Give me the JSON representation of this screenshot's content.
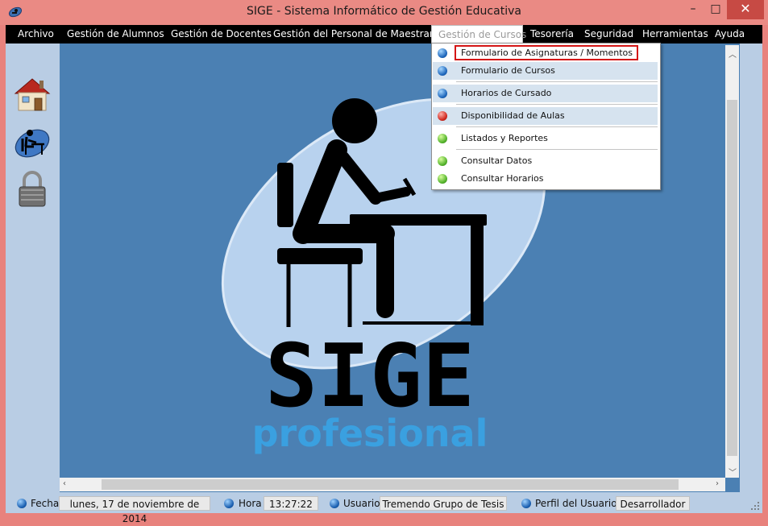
{
  "window": {
    "title": "SIGE - Sistema Informático de Gestión Educativa",
    "minimize_glyph": "–",
    "maximize_glyph": "□",
    "close_glyph": "✕"
  },
  "menubar": {
    "items": [
      {
        "label": "Archivo"
      },
      {
        "label": "Gestión de  Alumnos"
      },
      {
        "label": "Gestión de Docentes"
      },
      {
        "label": "Gestión del Personal de Maestranza"
      },
      {
        "label": "Gestión de Cursos"
      },
      {
        "label": "Tesorería"
      },
      {
        "label": "Seguridad"
      },
      {
        "label": "Herramientas"
      },
      {
        "label": "Ayuda"
      }
    ],
    "active_index": 4
  },
  "dropdown": {
    "items": [
      {
        "label": "Formulario de Asignaturas / Momentos",
        "dot": "blue",
        "highlighted": true
      },
      {
        "label": "Formulario de Cursos",
        "dot": "blue"
      },
      {
        "label": "Horarios de Cursado",
        "dot": "blue"
      },
      {
        "label": "Disponibilidad de Aulas",
        "dot": "red"
      },
      {
        "label": "Listados y Reportes",
        "dot": "green"
      },
      {
        "label": "Consultar Datos",
        "dot": "green"
      },
      {
        "label": "Consultar Horarios",
        "dot": "green"
      }
    ]
  },
  "sidebar": {
    "icons": [
      "home-icon",
      "student-desk-icon",
      "padlock-icon"
    ]
  },
  "logo": {
    "wordmark": "SIGE",
    "subtitle": "profesional"
  },
  "statusbar": {
    "fecha_label": "Fecha",
    "fecha_value": "lunes, 17 de noviembre de 2014",
    "hora_label": "Hora",
    "hora_value": "13:27:22",
    "usuario_label": "Usuario",
    "usuario_value": "Tremendo Grupo de Tesis",
    "perfil_label": "Perfil del Usuario",
    "perfil_value": "Desarrollador"
  },
  "colors": {
    "titlebar": "#ea8a84",
    "menubar": "#000000",
    "workspace": "#4b80b3",
    "accent_highlight": "#d41515",
    "logo_subtitle": "#3aa0e0"
  }
}
